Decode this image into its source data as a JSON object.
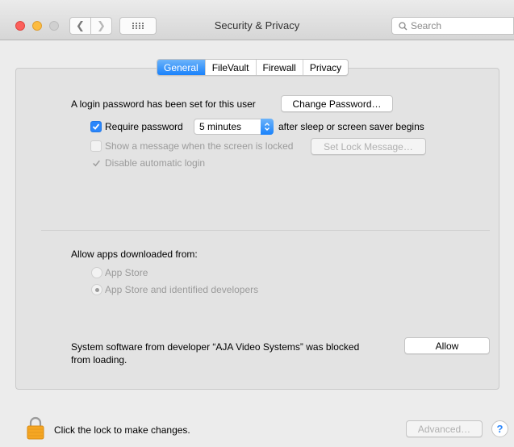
{
  "window": {
    "title": "Security & Privacy",
    "search_placeholder": "Search"
  },
  "tabs": [
    {
      "label": "General",
      "active": true
    },
    {
      "label": "FileVault",
      "active": false
    },
    {
      "label": "Firewall",
      "active": false
    },
    {
      "label": "Privacy",
      "active": false
    }
  ],
  "general": {
    "login_text": "A login password has been set for this user",
    "change_password_label": "Change Password…",
    "require_password_label": "Require password",
    "require_password_checked": true,
    "require_password_delay": "5 minutes",
    "require_password_suffix": "after sleep or screen saver begins",
    "show_message_label": "Show a message when the screen is locked",
    "show_message_checked": false,
    "set_lock_message_label": "Set Lock Message…",
    "disable_auto_login_label": "Disable automatic login",
    "disable_auto_login_checked": true
  },
  "apps": {
    "heading": "Allow apps downloaded from:",
    "options": [
      {
        "label": "App Store",
        "selected": false
      },
      {
        "label": "App Store and identified developers",
        "selected": true
      }
    ]
  },
  "blocked": {
    "line1": "System software from developer “AJA Video Systems” was blocked",
    "line2": "from loading.",
    "allow_label": "Allow"
  },
  "footer": {
    "lock_text": "Click the lock to make changes.",
    "advanced_label": "Advanced…",
    "help_label": "?"
  },
  "colors": {
    "accent": "#1a82fb",
    "lock": "#f5a623"
  }
}
